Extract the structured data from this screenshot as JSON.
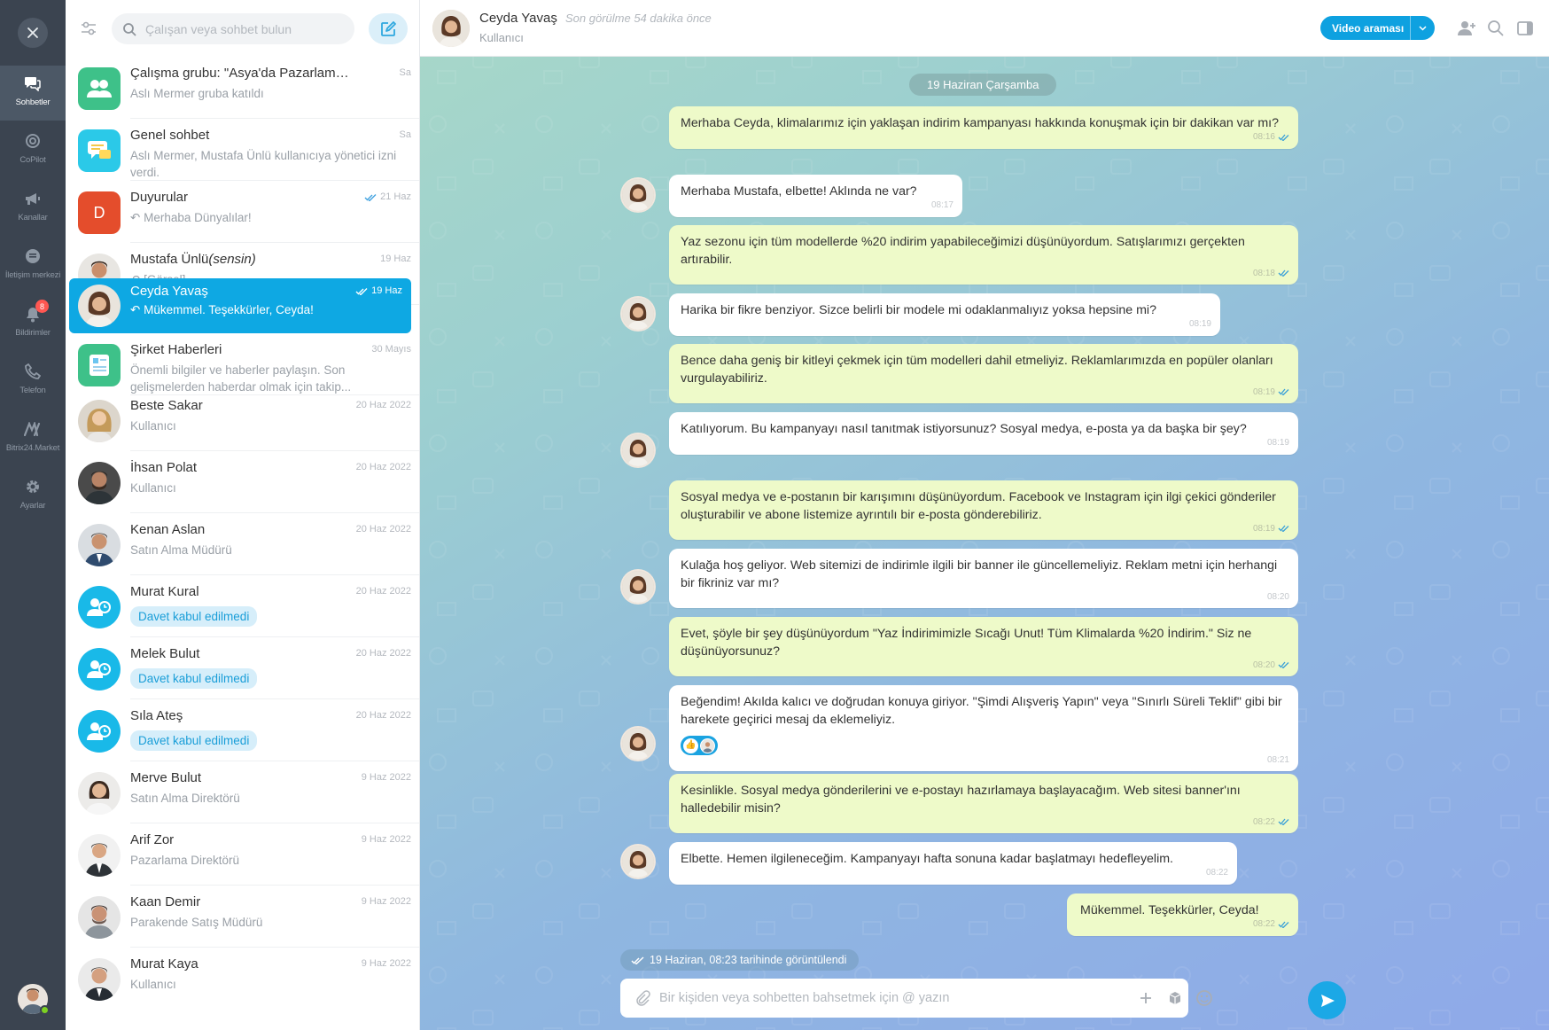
{
  "rail": {
    "items": [
      {
        "label": "Sohbetler",
        "icon": "chats-icon",
        "active": true
      },
      {
        "label": "CoPilot",
        "icon": "copilot-icon"
      },
      {
        "label": "Kanallar",
        "icon": "megaphone-icon"
      },
      {
        "label": "İletişim merkezi",
        "icon": "contact-center-icon"
      },
      {
        "label": "Bildirimler",
        "icon": "bell-icon",
        "badge": "8"
      },
      {
        "label": "Telefon",
        "icon": "phone-icon"
      },
      {
        "label": "Bitrix24.Market",
        "icon": "market-icon"
      },
      {
        "label": "Ayarlar",
        "icon": "gear-icon"
      }
    ]
  },
  "sidebar": {
    "search_placeholder": "Çalışan veya sohbet bulun",
    "chats": [
      {
        "name": "Çalışma grubu: \"Asya'da Pazarlama Pr...",
        "date": "Sa",
        "sub": "Aslı Mermer gruba katıldı",
        "avatar": "group",
        "color": "#3ec189"
      },
      {
        "name": "Genel sohbet",
        "date": "Sa",
        "sub": "Aslı Mermer, Mustafa Ünlü kullanıcıya yönetici izni verdi.",
        "avatar": "general",
        "color": "#2bc9e8"
      },
      {
        "name": "Duyurular",
        "date": "21 Haz",
        "sub": "Merhaba Dünyalılar!",
        "avatar": "D",
        "color": "#e44d2c",
        "read": true,
        "reply": true
      },
      {
        "name": "Mustafa Ünlü",
        "name_suffix": "(sensin)",
        "date": "19 Haz",
        "sub": "[Görsel]",
        "avatar": "photo",
        "reply": true
      },
      {
        "name": "Ceyda Yavaş",
        "date": "19 Haz",
        "sub": "Mükemmel. Teşekkürler, Ceyda!",
        "avatar": "photo",
        "active": true,
        "read": true,
        "reply": true
      },
      {
        "name": "Şirket Haberleri",
        "date": "30 Mayıs",
        "sub": "Önemli bilgiler ve haberler paylaşın. Son gelişmelerden haberdar olmak için takip...",
        "avatar": "news",
        "color": "#3ec189"
      },
      {
        "name": "Beste Sakar",
        "date": "20 Haz 2022",
        "sub": "Kullanıcı",
        "avatar": "photo"
      },
      {
        "name": "İhsan Polat",
        "date": "20 Haz 2022",
        "sub": "Kullanıcı",
        "avatar": "photo"
      },
      {
        "name": "Kenan Aslan",
        "date": "20 Haz 2022",
        "sub": "Satın Alma Müdürü",
        "avatar": "photo"
      },
      {
        "name": "Murat Kural",
        "date": "20 Haz 2022",
        "pill": "Davet kabul edilmedi",
        "avatar": "invite"
      },
      {
        "name": "Melek Bulut",
        "date": "20 Haz 2022",
        "pill": "Davet kabul edilmedi",
        "avatar": "invite"
      },
      {
        "name": "Sıla Ateş",
        "date": "20 Haz 2022",
        "pill": "Davet kabul edilmedi",
        "avatar": "invite"
      },
      {
        "name": "Merve Bulut",
        "date": "9 Haz 2022",
        "sub": "Satın Alma Direktörü",
        "avatar": "photo"
      },
      {
        "name": "Arif Zor",
        "date": "9 Haz 2022",
        "sub": "Pazarlama Direktörü",
        "avatar": "photo"
      },
      {
        "name": "Kaan Demir",
        "date": "9 Haz 2022",
        "sub": "Parakende Satış Müdürü",
        "avatar": "photo"
      },
      {
        "name": "Murat Kaya",
        "date": "9 Haz 2022",
        "sub": "Kullanıcı",
        "avatar": "photo"
      }
    ]
  },
  "header": {
    "name": "Ceyda Yavaş",
    "last_seen": "Son görülme 54 dakika önce",
    "role": "Kullanıcı",
    "video_label": "Video araması"
  },
  "chat": {
    "date_label": "19 Haziran Çarşamba",
    "messages": [
      {
        "dir": "out",
        "text": "Merhaba Ceyda, klimalarımız için yaklaşan indirim kampanyası hakkında konuşmak için bir dakikan var mı?",
        "time": "08:16"
      },
      {
        "dir": "in",
        "text": "Merhaba Mustafa, elbette! Aklında ne var?",
        "time": "08:17"
      },
      {
        "dir": "out",
        "text": "Yaz sezonu için tüm modellerde %20 indirim yapabileceğimizi düşünüyordum. Satışlarımızı gerçekten artırabilir.",
        "time": "08:18"
      },
      {
        "dir": "in",
        "text": "Harika bir fikre benziyor. Sizce belirli bir modele mi odaklanmalıyız yoksa hepsine mi?",
        "time": "08:19"
      },
      {
        "dir": "out",
        "text": "Bence daha geniş bir kitleyi çekmek için tüm modelleri dahil etmeliyiz. Reklamlarımızda en popüler olanları vurgulayabiliriz.",
        "time": "08:19"
      },
      {
        "dir": "in",
        "text": "Katılıyorum. Bu kampanyayı nasıl tanıtmak istiyorsunuz? Sosyal medya, e-posta ya da başka bir şey?",
        "time": "08:19"
      },
      {
        "dir": "out",
        "text": "Sosyal medya ve e-postanın bir karışımını düşünüyordum. Facebook ve Instagram için ilgi çekici gönderiler oluşturabilir ve abone listemize ayrıntılı bir e-posta gönderebiliriz.",
        "time": "08:19"
      },
      {
        "dir": "in",
        "text": "Kulağa hoş geliyor. Web sitemizi de indirimle ilgili bir banner ile güncellemeliyiz. Reklam metni için herhangi bir fikriniz var mı?",
        "time": "08:20"
      },
      {
        "dir": "out",
        "text": "Evet, şöyle bir şey düşünüyordum \"Yaz İndirimimizle Sıcağı Unut! Tüm Klimalarda %20 İndirim.\" Siz ne düşünüyorsunuz?",
        "time": "08:20"
      },
      {
        "dir": "in",
        "text": "Beğendim! Akılda kalıcı ve doğrudan konuya giriyor. \"Şimdi Alışveriş Yapın\" veya \"Sınırlı Süreli Teklif\" gibi bir harekete geçirici mesaj da eklemeliyiz.",
        "time": "08:21",
        "reaction": "like"
      },
      {
        "dir": "out",
        "text": "Kesinlikle. Sosyal medya gönderilerini ve e-postayı hazırlamaya başlayacağım. Web sitesi banner'ını halledebilir misin?",
        "time": "08:22"
      },
      {
        "dir": "in",
        "text": "Elbette. Hemen ilgileneceğim. Kampanyayı hafta sonuna kadar başlatmayı hedefleyelim.",
        "time": "08:22"
      },
      {
        "dir": "out",
        "text": "Mükemmel. Teşekkürler, Ceyda!",
        "time": "08:22"
      }
    ],
    "seen_label": "19 Haziran, 08:23 tarihinde görüntülendi",
    "composer_placeholder": "Bir kişiden veya sohbetten bahsetmek için @ yazın"
  },
  "colors": {
    "accent": "#0ea8e3",
    "outgoing_bubble": "#eefac9",
    "rail_bg": "#3b4450"
  }
}
